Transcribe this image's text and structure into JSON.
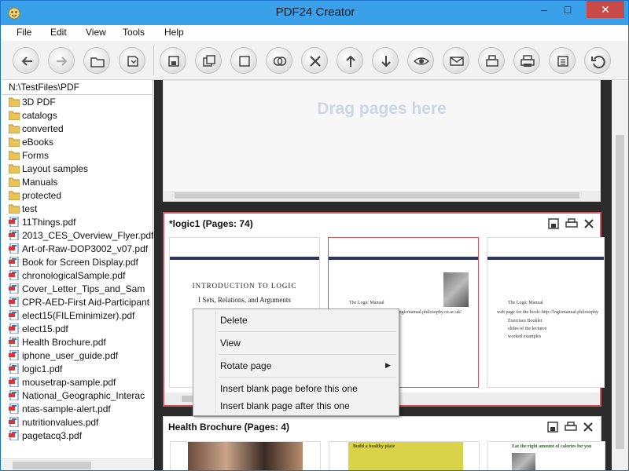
{
  "window": {
    "title": "PDF24 Creator",
    "minimize": "–",
    "maximize": "□",
    "close": "✕"
  },
  "menu": [
    "File",
    "Edit",
    "View",
    "Tools",
    "Help"
  ],
  "toolbar": [
    "back-icon",
    "forward-icon",
    "open-folder-icon",
    "import-icon",
    "save-icon",
    "save-all-icon",
    "blank-page-icon",
    "merge-icon",
    "delete-icon",
    "move-up-icon",
    "move-down-icon",
    "preview-icon",
    "email-icon",
    "fax-icon",
    "print-icon",
    "compress-icon",
    "undo-icon"
  ],
  "sidebar": {
    "path": "N:\\TestFiles\\PDF",
    "items": [
      {
        "type": "folder",
        "name": "3D PDF"
      },
      {
        "type": "folder",
        "name": "catalogs"
      },
      {
        "type": "folder",
        "name": "converted"
      },
      {
        "type": "folder",
        "name": "eBooks"
      },
      {
        "type": "folder",
        "name": "Forms"
      },
      {
        "type": "folder",
        "name": "Layout samples"
      },
      {
        "type": "folder",
        "name": "Manuals"
      },
      {
        "type": "folder",
        "name": "protected"
      },
      {
        "type": "folder",
        "name": "test"
      },
      {
        "type": "pdf",
        "name": "11Things.pdf"
      },
      {
        "type": "pdf",
        "name": "2013_CES_Overview_Flyer.pdf"
      },
      {
        "type": "pdf",
        "name": "Art-of-Raw-DOP3002_v07.pdf"
      },
      {
        "type": "pdf",
        "name": "Book for Screen Display.pdf"
      },
      {
        "type": "pdf",
        "name": "chronologicalSample.pdf"
      },
      {
        "type": "pdf",
        "name": "Cover_Letter_Tips_and_Sam"
      },
      {
        "type": "pdf",
        "name": "CPR-AED-First Aid-Participant"
      },
      {
        "type": "pdf",
        "name": "elect15(FILEminimizer).pdf"
      },
      {
        "type": "pdf",
        "name": "elect15.pdf"
      },
      {
        "type": "pdf",
        "name": "Health Brochure.pdf"
      },
      {
        "type": "pdf",
        "name": "iphone_user_guide.pdf"
      },
      {
        "type": "pdf",
        "name": "logic1.pdf"
      },
      {
        "type": "pdf",
        "name": "mousetrap-sample.pdf"
      },
      {
        "type": "pdf",
        "name": "National_Geographic_Interac"
      },
      {
        "type": "pdf",
        "name": "ntas-sample-alert.pdf"
      },
      {
        "type": "pdf",
        "name": "nutritionvalues.pdf"
      },
      {
        "type": "pdf",
        "name": "pagetacq3.pdf"
      }
    ]
  },
  "workspace": {
    "drop_zone_text": "Drag pages here",
    "documents": [
      {
        "title": "*logic1 (Pages: 74)",
        "pages": [
          {
            "heading": "INTRODUCTION TO LOGIC",
            "subheading": "I Sets, Relations, and Arguments"
          },
          {
            "bullets": [
              "The Logic Manual",
              "logicmanual.philosophy.ox.ac.uk/"
            ]
          },
          {
            "bullets": [
              "The Logic Manual",
              "web page for the book: http://logicmanual.philosophy",
              "Exercises Booklet",
              "slides of the lectures",
              "worked examples"
            ]
          }
        ]
      },
      {
        "title": "Health Brochure (Pages: 4)",
        "pages": [
          {
            "caption": ""
          },
          {
            "caption": "Build a healthy plate"
          },
          {
            "caption": "Eat the right amount of calories for you"
          }
        ]
      }
    ]
  },
  "context_menu": {
    "items": [
      "Delete",
      "View",
      "Rotate page",
      "Insert blank page before this one",
      "Insert blank page after this one"
    ],
    "submenu_arrow": "▶"
  },
  "colors": {
    "titlebar": "#3aa0ea",
    "selection_border": "#d2575a",
    "drop_text": "#cdd6e3"
  }
}
